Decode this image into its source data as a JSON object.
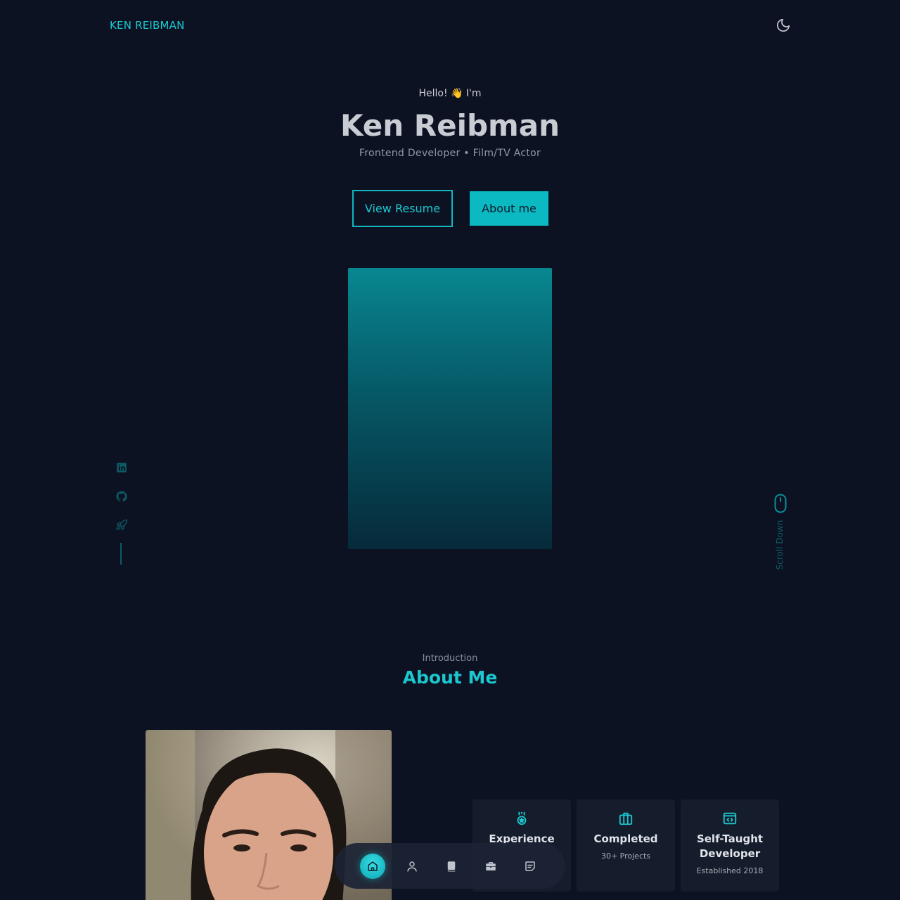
{
  "header": {
    "brand": "KEN REIBMAN",
    "theme_toggle_icon": "moon-icon"
  },
  "hero": {
    "greeting": "Hello! 👋 I'm",
    "name": "Ken Reibman",
    "subtitle": "Frontend Developer • Film/TV Actor",
    "buttons": {
      "resume": "View Resume",
      "about": "About me"
    }
  },
  "socials": [
    {
      "icon": "linkedin-icon"
    },
    {
      "icon": "github-icon"
    },
    {
      "icon": "rocket-icon"
    }
  ],
  "scroll_down": {
    "label": "Scroll Down",
    "icon": "mouse-icon"
  },
  "about": {
    "subtitle": "Introduction",
    "title": "About Me",
    "cards": [
      {
        "icon": "award-icon",
        "title": "Experience",
        "sub": ""
      },
      {
        "icon": "briefcase-icon",
        "title": "Completed",
        "sub": "30+ Projects"
      },
      {
        "icon": "code-icon",
        "title": "Self-Taught Developer",
        "sub": "Established 2018"
      }
    ]
  },
  "bottom_nav": [
    {
      "icon": "home-icon",
      "active": true
    },
    {
      "icon": "user-icon",
      "active": false
    },
    {
      "icon": "book-icon",
      "active": false
    },
    {
      "icon": "briefcase-icon",
      "active": false
    },
    {
      "icon": "message-icon",
      "active": false
    }
  ],
  "colors": {
    "background": "#0c1222",
    "accent": "#1cc7cf",
    "card": "#151d2c"
  }
}
